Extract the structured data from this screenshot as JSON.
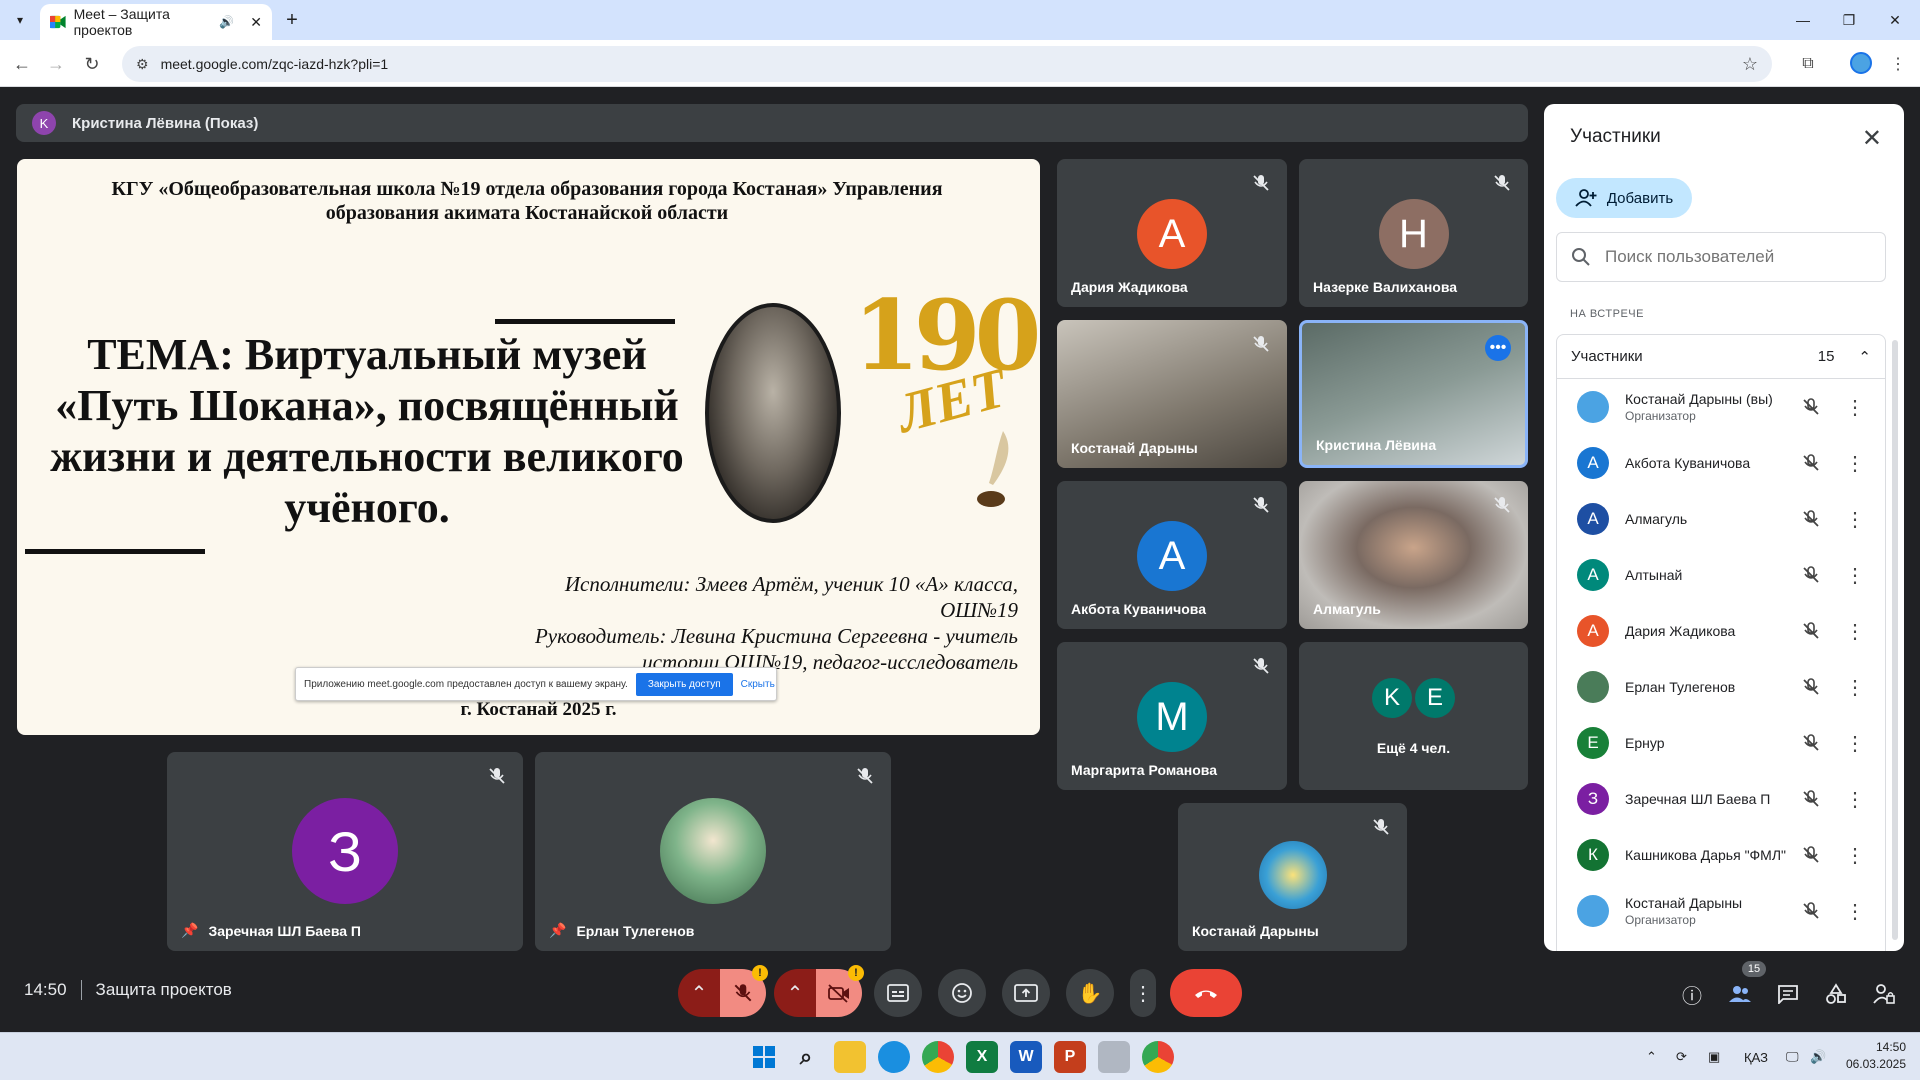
{
  "browser": {
    "tab_title": "Meet – Защита проектов",
    "url": "meet.google.com/zqc-iazd-hzk?pli=1"
  },
  "presenter": {
    "avatar_letter": "K",
    "label": "Кристина Лёвина (Показ)"
  },
  "slide": {
    "org_line1": "КГУ «Общеобразовательная школа №19 отдела образования города Костаная» Управления",
    "org_line2": "образования акимата Костанайской области",
    "topic_line1": "ТЕМА: Виртуальный музей",
    "topic_line2": "«Путь Шокана», посвящённый",
    "topic_line3": "жизни и деятельности великого",
    "topic_line4": "учёного.",
    "anniversary_number": "190",
    "anniversary_word": "ЛЕТ",
    "performer_line1": "Исполнители: Змеев Артём, ученик 10 «А» класса,",
    "performer_line2": "ОШ№19",
    "leader_line1": "Руководитель: Левина Кристина Сергеевна - учитель",
    "leader_line2": "истории ОШ№19, педагог-исследователь",
    "city": "г. Костанай 2025 г.",
    "share_notice_text": "Приложению meet.google.com предоставлен доступ к вашему экрану.",
    "share_notice_stop": "Закрыть доступ",
    "share_notice_hide": "Скрыть"
  },
  "tiles": {
    "t1": {
      "name": "Дария Жадикова",
      "letter": "А",
      "color": "#e8542a"
    },
    "t2": {
      "name": "Назерке Валиханова",
      "letter": "Н",
      "color": "#8d6e63"
    },
    "t3": {
      "name": "Костанай Дарыны"
    },
    "t4": {
      "name": "Кристина Лёвина"
    },
    "t5": {
      "name": "Акбота Куваничова",
      "letter": "А",
      "color": "#1976d2"
    },
    "t6": {
      "name": "Алмагуль"
    },
    "t7": {
      "name": "Маргарита Романова",
      "letter": "М",
      "color": "#00838f"
    },
    "t8": {
      "name": "Ещё 4 чел.",
      "letter_a": "K",
      "letter_b": "E",
      "color_a": "#00796b",
      "color_b": "#00796b"
    },
    "b1": {
      "name": "Заречная ШЛ Баева П",
      "letter": "З",
      "color": "#7b1fa2"
    },
    "b2": {
      "name": "Ерлан Тулегенов"
    },
    "b3": {
      "name": "Костанай Дарыны"
    }
  },
  "bottom": {
    "time": "14:50",
    "meeting_name": "Защита проектов",
    "people_count": "15"
  },
  "panel": {
    "title": "Участники",
    "add_label": "Добавить",
    "search_placeholder": "Поиск пользователей",
    "section_label": "НА ВСТРЕЧЕ",
    "group_label": "Участники",
    "group_count": "15",
    "participants": [
      {
        "name": "Костанай Дарыны (вы)",
        "role": "Организатор",
        "letter": "",
        "color": "#4ba3e3"
      },
      {
        "name": "Акбота Куваничова",
        "role": "",
        "letter": "А",
        "color": "#1976d2"
      },
      {
        "name": "Алмагуль",
        "role": "",
        "letter": "А",
        "color": "#1e4fa3"
      },
      {
        "name": "Алтынай",
        "role": "",
        "letter": "А",
        "color": "#00897b"
      },
      {
        "name": "Дария Жадикова",
        "role": "",
        "letter": "А",
        "color": "#e8542a"
      },
      {
        "name": "Ерлан Тулегенов",
        "role": "",
        "letter": "",
        "color": "#4a7c59"
      },
      {
        "name": "Ернур",
        "role": "",
        "letter": "Е",
        "color": "#188038"
      },
      {
        "name": "Заречная ШЛ Баева П",
        "role": "",
        "letter": "З",
        "color": "#7b1fa2"
      },
      {
        "name": "Кашникова Дарья \"ФМЛ\"",
        "role": "",
        "letter": "К",
        "color": "#137333"
      },
      {
        "name": "Костанай Дарыны",
        "role": "Организатор",
        "letter": "",
        "color": "#4ba3e3"
      }
    ]
  },
  "taskbar": {
    "lang": "ҚАЗ",
    "clock_time": "14:50",
    "clock_date": "06.03.2025"
  }
}
